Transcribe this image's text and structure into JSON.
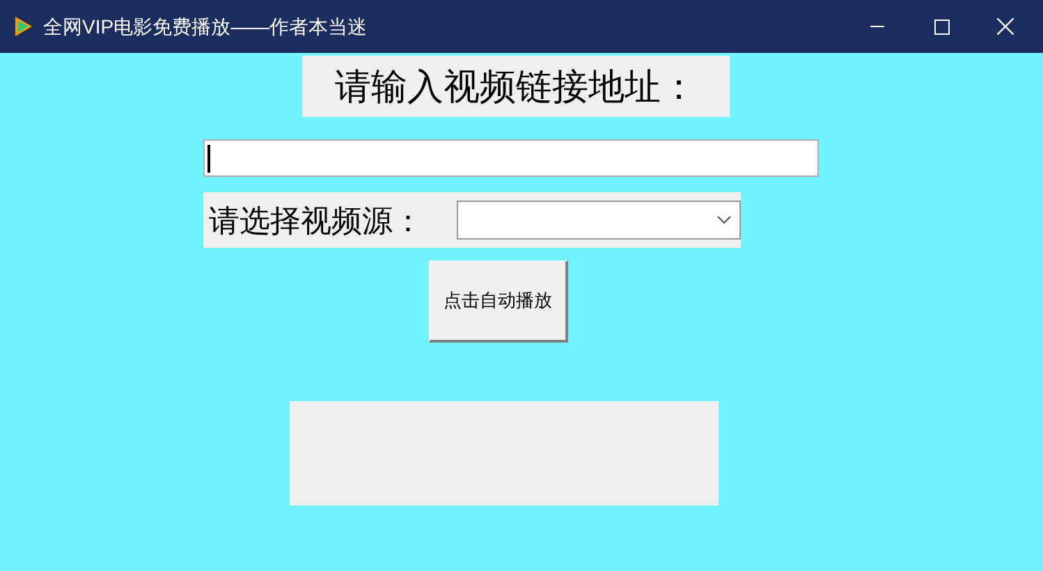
{
  "window": {
    "title": "全网VIP电影免费播放——作者本当迷"
  },
  "heading": "请输入视频链接地址：",
  "url_field": {
    "focused": true
  },
  "source_label": "请选择视频源：",
  "play_button": "点击自动播放"
}
